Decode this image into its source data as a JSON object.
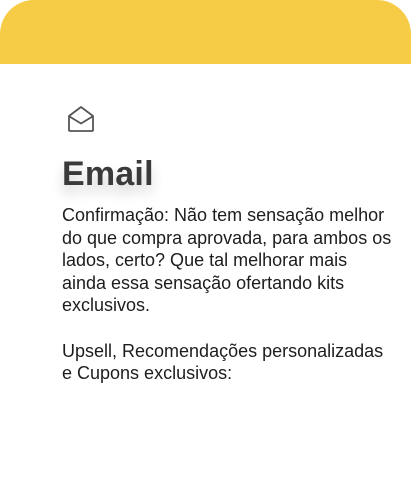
{
  "colors": {
    "accent": "#f6cc47",
    "title": "#3a3a3a",
    "text": "#1d1d1d",
    "icon": "#555555"
  },
  "header": {
    "icon": "envelope-open-icon",
    "title": "Email"
  },
  "body": {
    "paragraph_1": "Confirmação: Não tem sensação melhor do que compra aprovada, para ambos os lados, certo? Que tal melhorar mais ainda essa sensação ofertando kits exclusivos.",
    "paragraph_2": "Upsell, Recomendações personalizadas e Cupons exclusivos:"
  }
}
